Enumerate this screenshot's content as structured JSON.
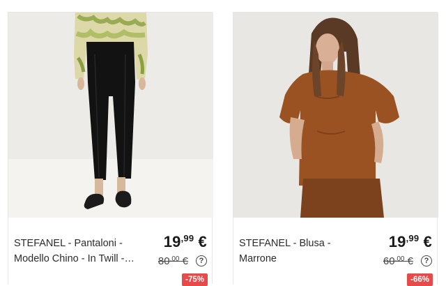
{
  "products": [
    {
      "title": "STEFANEL - Pantaloni - Modello Chino - In Twill - Nero",
      "price_main": "19",
      "price_cents": ",99",
      "price_currency": " €",
      "old_main": "80",
      "old_cents": ",00",
      "old_currency": " €",
      "discount": "-75%",
      "help": "?",
      "image": "black-trousers-photo"
    },
    {
      "title": "STEFANEL - Blusa - Marrone",
      "price_main": "19",
      "price_cents": ",99",
      "price_currency": " €",
      "old_main": "60",
      "old_cents": ",00",
      "old_currency": " €",
      "discount": "-66%",
      "help": "?",
      "image": "brown-blouse-photo"
    }
  ],
  "colors": {
    "badge": "#e84a4a",
    "photo_bg": "#ecebe7"
  }
}
